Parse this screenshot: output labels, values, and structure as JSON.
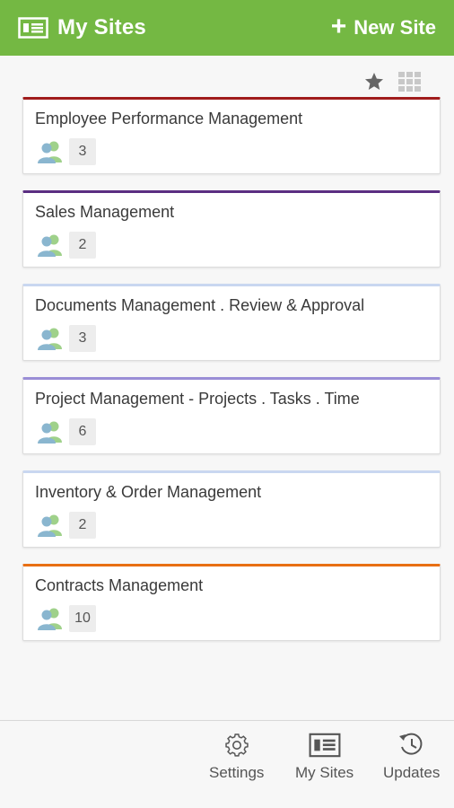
{
  "header": {
    "title": "My Sites",
    "new_site_label": "New Site",
    "accent": "#74b843"
  },
  "view_toggle": {
    "favorites_icon": "star-icon",
    "grid_icon": "grid-icon"
  },
  "sites": [
    {
      "name": "Employee Performance Management",
      "members": "3",
      "color": "#a01c1c"
    },
    {
      "name": "Sales Management",
      "members": "2",
      "color": "#5b2e82"
    },
    {
      "name": "Documents Management . Review & Approval",
      "members": "3",
      "color": "#c9d7f0"
    },
    {
      "name": "Project Management - Projects . Tasks . Time",
      "members": "6",
      "color": "#9a8ed6"
    },
    {
      "name": "Inventory & Order Management",
      "members": "2",
      "color": "#c9d7f0"
    },
    {
      "name": "Contracts Management",
      "members": "10",
      "color": "#e86f13"
    }
  ],
  "bottom_nav": {
    "settings_label": "Settings",
    "my_sites_label": "My Sites",
    "updates_label": "Updates"
  }
}
